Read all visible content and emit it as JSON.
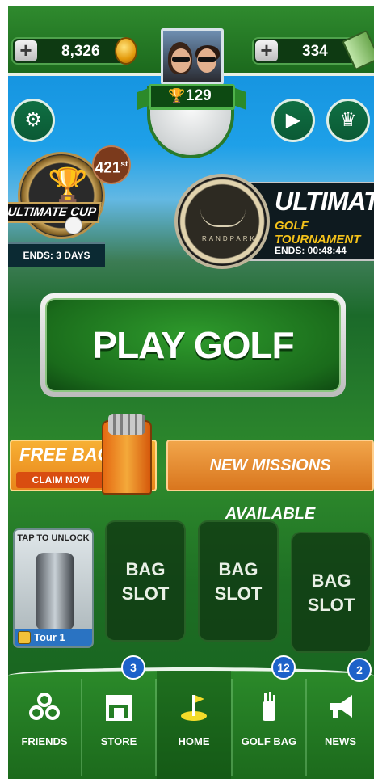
{
  "header": {
    "coins": "8,326",
    "cash": "334",
    "trophies": "129"
  },
  "events": {
    "left": {
      "title": "ULTIMATE CUP",
      "rank": "421",
      "rank_suffix": "st",
      "ends": "ENDS: 3 DAYS"
    },
    "right": {
      "logo_text": "RANDPARK",
      "title": "ULTIMATE!",
      "subtitle": "GOLF TOURNAMENT",
      "ends": "ENDS: 00:48:44"
    }
  },
  "main": {
    "play_label": "PLAY GOLF",
    "free_bag": {
      "title": "FREE BAG",
      "claim": "CLAIM NOW"
    },
    "missions_label": "NEW MISSIONS AVAILABLE"
  },
  "bags": {
    "card": {
      "tap_label": "TAP TO UNLOCK",
      "tour_label": "Tour 1"
    },
    "slots": [
      {
        "line1": "BAG",
        "line2": "SLOT"
      },
      {
        "line1": "BAG",
        "line2": "SLOT"
      },
      {
        "line1": "BAG",
        "line2": "SLOT"
      }
    ]
  },
  "nav": {
    "items": [
      {
        "label": "FRIENDS",
        "icon": "friends-icon"
      },
      {
        "label": "STORE",
        "icon": "store-icon",
        "badge": "3"
      },
      {
        "label": "HOME",
        "icon": "home-flag-icon"
      },
      {
        "label": "GOLF BAG",
        "icon": "golf-bag-icon",
        "badge": "12"
      },
      {
        "label": "NEWS",
        "icon": "megaphone-icon",
        "badge": "2"
      }
    ]
  },
  "colors": {
    "accent_green": "#1c6a1d",
    "gold": "#f4c21a",
    "orange": "#e8851a",
    "badge_blue": "#1d62c9"
  }
}
